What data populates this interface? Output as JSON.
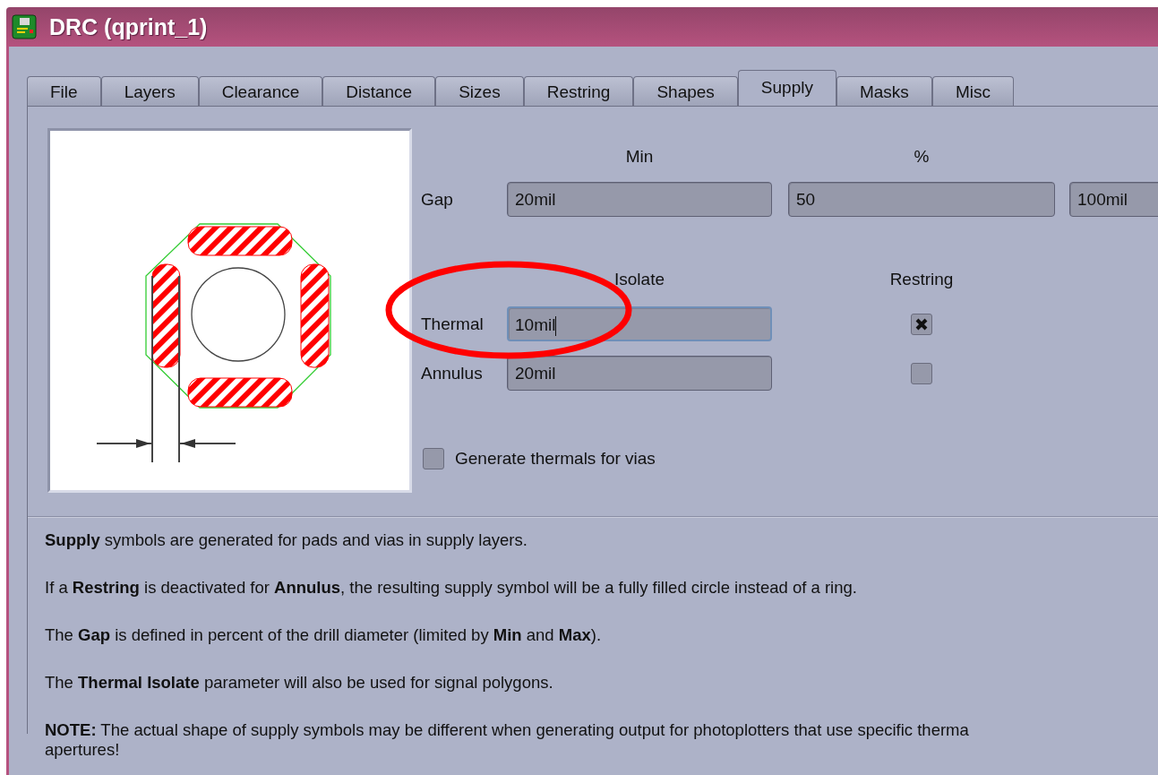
{
  "window": {
    "title": "DRC (qprint_1)"
  },
  "tabs": [
    {
      "label": "File",
      "selected": false
    },
    {
      "label": "Layers",
      "selected": false
    },
    {
      "label": "Clearance",
      "selected": false
    },
    {
      "label": "Distance",
      "selected": false
    },
    {
      "label": "Sizes",
      "selected": false
    },
    {
      "label": "Restring",
      "selected": false
    },
    {
      "label": "Shapes",
      "selected": false
    },
    {
      "label": "Supply",
      "selected": true
    },
    {
      "label": "Masks",
      "selected": false
    },
    {
      "label": "Misc",
      "selected": false
    }
  ],
  "supply": {
    "min_header": "Min",
    "percent_header": "%",
    "gap": {
      "label": "Gap",
      "min": "20mil",
      "percent": "50",
      "max": "100mil"
    },
    "isolate_header": "Isolate",
    "restring_header": "Restring",
    "rows": [
      {
        "label": "Thermal",
        "value": "10mil",
        "focused": true,
        "restring": true
      },
      {
        "label": "Annulus",
        "value": "20mil",
        "focused": false,
        "restring": false
      }
    ],
    "vias": {
      "label": "Generate thermals for vias",
      "checked": false
    }
  },
  "help": [
    {
      "lines": [
        "**Supply** symbols are generated for pads and vias in supply layers."
      ]
    },
    {
      "lines": [
        "If a **Restring** is deactivated for **Annulus**, the resulting supply symbol will be a fully filled circle instead of a ring."
      ]
    },
    {
      "lines": [
        "The **Gap** is defined in percent of the drill diameter (limited by **Min** and **Max**)."
      ]
    },
    {
      "lines": [
        "The **Thermal Isolate** parameter will also be used for signal polygons."
      ]
    },
    {
      "lines": [
        "**NOTE:** The actual shape of supply symbols may be different when generating output for photoplotters that use specific therma",
        "apertures!"
      ]
    }
  ]
}
